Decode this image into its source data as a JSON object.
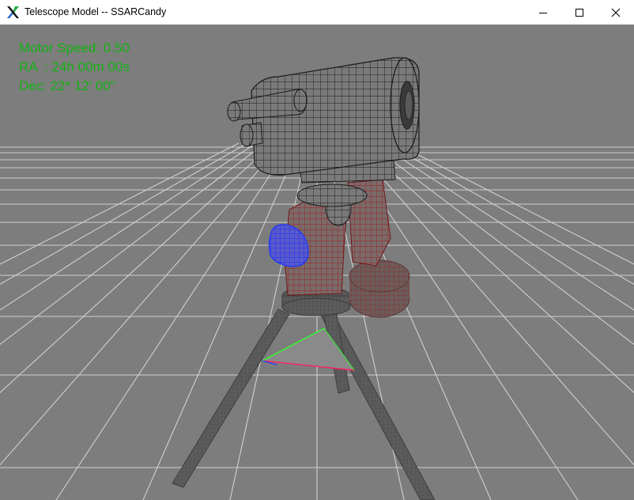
{
  "window": {
    "title": "Telescope Model -- SSARCandy",
    "icon": "x-app-icon",
    "controls": {
      "minimize_icon": "minimize-icon",
      "maximize_icon": "maximize-icon",
      "close_icon": "close-icon"
    }
  },
  "hud": {
    "motor_speed": "Motor Speed: 0.50",
    "ra": "RA  : 24h 00m 00s",
    "dec": "Dec: 22* 12' 00\""
  },
  "colors": {
    "background": "#7d7d7d",
    "grid": "#d0d0d0",
    "hud_text": "#13b213",
    "tube_wire": "#1a1a1a",
    "mount_wire": "#a02020",
    "lens_cap": "#1a33ff",
    "axis_x": "#ff2060",
    "axis_y": "#30ff30",
    "axis_z": "#2040ff"
  }
}
